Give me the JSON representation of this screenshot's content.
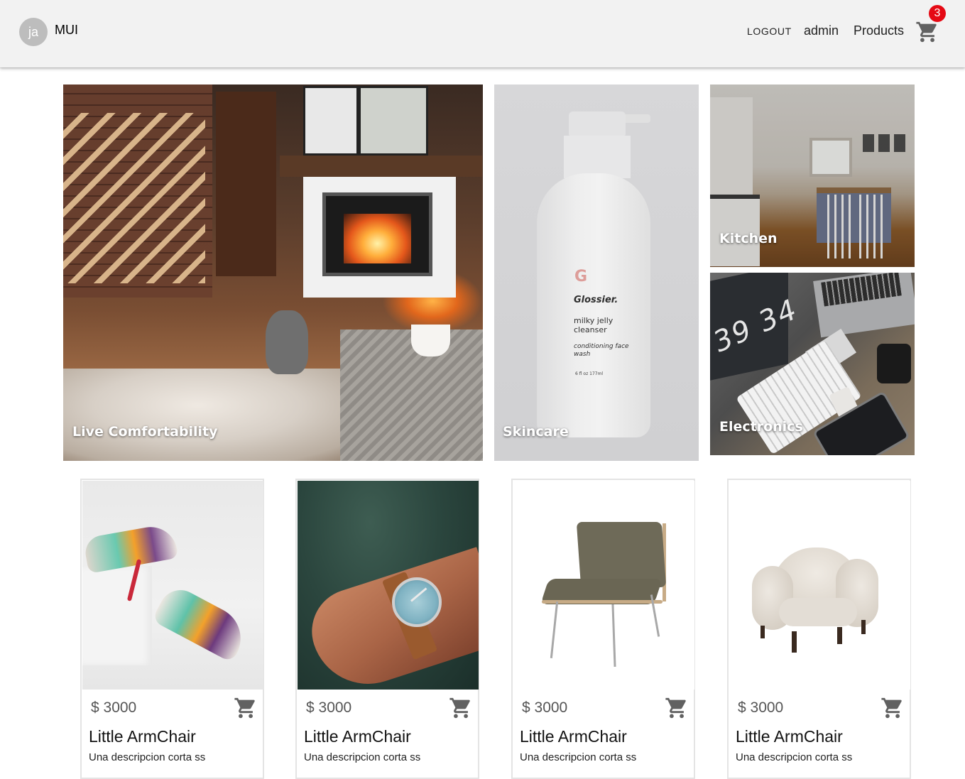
{
  "appbar": {
    "avatar_text": "ja",
    "brand": "MUI",
    "logout_label": "Logout",
    "admin_label": "admin",
    "products_label": "Products",
    "cart_badge": "3",
    "cart_icon": "shopping-cart-icon",
    "badge_color": "#e50914"
  },
  "categories": [
    {
      "label": "Live Comfortability"
    },
    {
      "label": "Skincare"
    },
    {
      "label": "Kitchen"
    },
    {
      "label": "Electronics"
    }
  ],
  "skincare_bottle": {
    "logo": "G",
    "brand": "Glossier.",
    "line1": "milky jelly cleanser",
    "line2": "conditioning face wash",
    "line3": "6 fl oz  177ml"
  },
  "electronics_clock": "39 34",
  "products": [
    {
      "price": "$ 3000",
      "title": "Little ArmChair",
      "description": "Una descripcion corta ss",
      "image": "sneakers"
    },
    {
      "price": "$ 3000",
      "title": "Little ArmChair",
      "description": "Una descripcion corta ss",
      "image": "wrist-watch"
    },
    {
      "price": "$ 3000",
      "title": "Little ArmChair",
      "description": "Una descripcion corta ss",
      "image": "lounge-chair"
    },
    {
      "price": "$ 3000",
      "title": "Little ArmChair",
      "description": "Una descripcion corta ss",
      "image": "armchair"
    }
  ]
}
